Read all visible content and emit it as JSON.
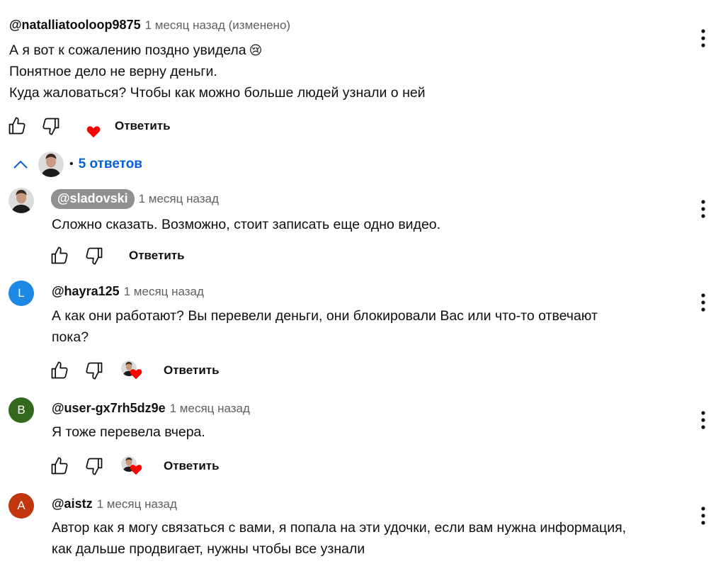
{
  "colors": {
    "link": "#065fd4",
    "heart": "#ff0000",
    "chip": "#909090",
    "avatar_l": "#1e88e5",
    "avatar_b": "#33691e",
    "avatar_a": "#c1350f"
  },
  "top_comment": {
    "author": "@natalliatooloop9875",
    "time": "1 месяц назад (изменено)",
    "lines": [
      "А я вот к сожалению поздно увидела",
      "Понятное дело не верну деньги.",
      "Куда жаловаться? Чтобы как можно больше людей узнали о ней"
    ],
    "emoji": "😢",
    "reply_label": "Ответить"
  },
  "replies_toggle": {
    "dot": "•",
    "label": "5 ответов"
  },
  "replies": [
    {
      "author": "@sladovski",
      "time": "1 месяц назад",
      "lines": [
        "Сложно сказать. Возможно, стоит записать еще одно видео."
      ],
      "reply_label": "Ответить"
    },
    {
      "author": "@hayra125",
      "time": "1 месяц назад",
      "avatar_letter": "L",
      "lines": [
        "А как они работают? Вы перевели деньги, они блокировали Вас или что-то отвечают",
        "пока?"
      ],
      "reply_label": "Ответить"
    },
    {
      "author": "@user-gx7rh5dz9e",
      "time": "1 месяц назад",
      "avatar_letter": "B",
      "lines": [
        "Я тоже перевела вчера."
      ],
      "reply_label": "Ответить"
    },
    {
      "author": "@aistz",
      "time": "1 месяц назад",
      "avatar_letter": "A",
      "lines": [
        "Автор как я могу связаться с вами, я попала на эти удочки, если вам нужна информация,",
        "как дальше продвигает, нужны чтобы все узнали"
      ]
    }
  ]
}
